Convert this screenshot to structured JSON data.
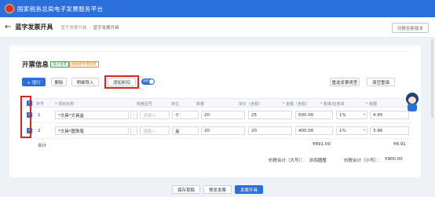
{
  "app": {
    "title": "国家税务总局电子发票服务平台"
  },
  "header": {
    "back_icon": "back-arrow-icon",
    "page_title": "蓝字发票开具",
    "breadcrumb": [
      "蓝字发票开具",
      "蓝字发票开具"
    ],
    "switch_button": "切换至新版本"
  },
  "section": {
    "title": "开票信息",
    "tags": [
      "电子发票",
      "增值税专用发票"
    ]
  },
  "toolbar": {
    "add_row": "+ 增行",
    "delete": "删除",
    "batch_import": "明细导入",
    "add_discount": "添加折扣",
    "toggle_label": "含税",
    "rechoose_type": "重选发票类型",
    "clear": "清空重填"
  },
  "table": {
    "headers": [
      "序号",
      "* 项目名称",
      "规格型号",
      "单位",
      "数量",
      "单价（含税）",
      "* 金额（含税）",
      "* 税率/征收率",
      "* 税额"
    ],
    "rows": [
      {
        "index": "1",
        "name": "*文具*文具盒",
        "spec_placeholder": "请输入",
        "unit": "个",
        "quantity": "20",
        "unit_price": "25",
        "amount": "500.00",
        "tax_rate": "1%",
        "tax": "4.95"
      },
      {
        "index": "2",
        "name": "*文具*圆珠笔",
        "spec_placeholder": "请输入",
        "unit": "盒",
        "quantity": "20",
        "unit_price": "20",
        "amount": "400.00",
        "tax_rate": "1%",
        "tax": "3.96"
      }
    ],
    "total_label": "合计",
    "total_amount": "¥891.09",
    "total_tax": "¥8.91",
    "sum_words_label": "价税合计（大写）：",
    "sum_words": "玖佰圆整",
    "sum_num_label": "价税合计（小写）：",
    "sum_num": "¥900.00"
  },
  "footer": {
    "save_draft": "保存草稿",
    "preview": "预览发票",
    "issue": "发票开具"
  },
  "colors": {
    "primary": "#2a6fdb",
    "highlight": "#d9261c"
  }
}
